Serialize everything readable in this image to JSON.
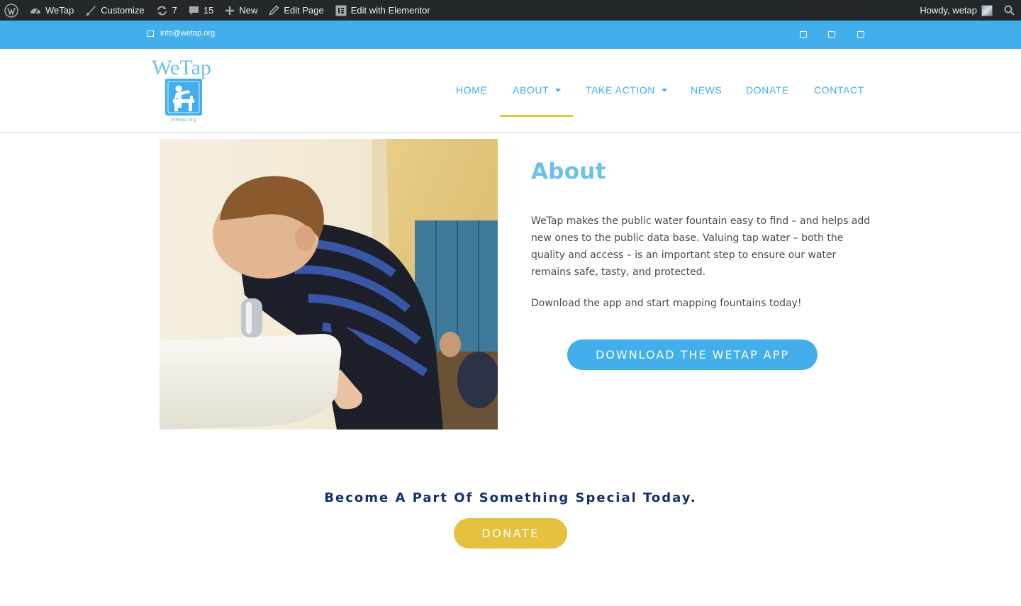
{
  "admin_bar": {
    "site_name": "WeTap",
    "customize": "Customize",
    "updates_count": "7",
    "comments_count": "15",
    "new_label": "New",
    "edit_page": "Edit Page",
    "edit_elementor": "Edit with Elementor",
    "howdy": "Howdy, wetap"
  },
  "topbar": {
    "email": "info@wetap.org",
    "social_icons": [
      "social-icon-1",
      "social-icon-2",
      "social-icon-3"
    ]
  },
  "logo": {
    "wordmark": "WeTap",
    "url_text": "wetap.org"
  },
  "nav": {
    "items": [
      {
        "label": "HOME"
      },
      {
        "label": "ABOUT"
      },
      {
        "label": "TAKE ACTION"
      },
      {
        "label": "NEWS"
      },
      {
        "label": "DONATE"
      },
      {
        "label": "CONTACT"
      }
    ],
    "active": "ABOUT"
  },
  "about": {
    "title": "About",
    "paragraph1": "WeTap makes the public water fountain easy to find – and helps add new ones to the public data base. Valuing tap water – both the quality and access – is an important step to ensure our water remains safe, tasty, and protected.",
    "paragraph2": "Download the app and start mapping fountains today!",
    "app_button": "DOWNLOAD THE WETAP APP"
  },
  "cta": {
    "tagline": "Become A Part Of Something Special Today.",
    "donate_button": "DONATE"
  },
  "colors": {
    "admin_bar": "#23282d",
    "brand_blue": "#42aeec",
    "title_blue": "#6cc0ea",
    "navy": "#14306a",
    "gold": "#e4c13f"
  }
}
